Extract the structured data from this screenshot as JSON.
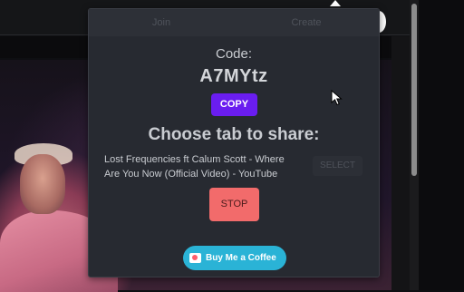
{
  "popup": {
    "tabs": [
      {
        "label": "Join"
      },
      {
        "label": "Create"
      }
    ],
    "code_label": "Code:",
    "code_value": "A7MYtz",
    "copy_label": "COPY",
    "share_title": "Choose tab to share:",
    "tab_title": "Lost Frequencies ft Calum Scott - Where Are You Now (Official Video) - YouTube",
    "select_label": "SELECT",
    "stop_label": "STOP",
    "coffee_label": "Buy Me a Coffee"
  },
  "colors": {
    "popup_bg": "#272a31",
    "copy_button": "#6a1df0",
    "stop_button": "#f26b6b",
    "coffee_button": "#2ab3d6"
  },
  "icons": {
    "coffee": "coffee-cup-icon",
    "cursor": "mouse-pointer-icon"
  }
}
